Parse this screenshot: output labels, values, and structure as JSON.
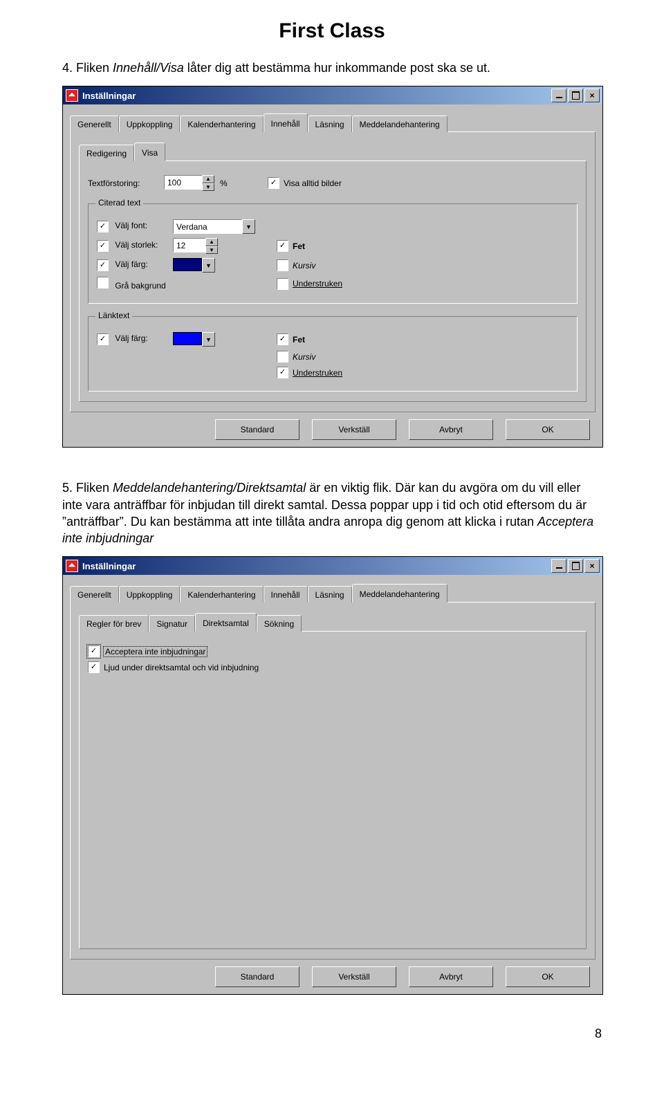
{
  "doc": {
    "title": "First Class",
    "para4_prefix": "4. Fliken ",
    "para4_em": "Innehåll/Visa",
    "para4_rest": " låter dig att bestämma hur inkommande post ska se ut.",
    "para5_prefix": "5. Fliken ",
    "para5_em": "Meddelandehantering/Direktsamtal",
    "para5_rest1": " är en viktig flik. Där kan du avgöra om du vill eller inte vara anträffbar för inbjudan till direkt samtal. Dessa poppar upp i tid och otid eftersom du är ”anträffbar”. Du kan bestämma att inte tillåta andra anropa dig genom att klicka i rutan ",
    "para5_em2": "Acceptera inte inbjudningar",
    "pagenum": "8"
  },
  "win1": {
    "title": "Inställningar",
    "tabs_outer": [
      "Generellt",
      "Uppkoppling",
      "Kalenderhantering",
      "Innehåll",
      "Läsning",
      "Meddelandehantering"
    ],
    "tabs_outer_active": 3,
    "tabs_inner": [
      "Redigering",
      "Visa"
    ],
    "tabs_inner_active": 1,
    "textzoom_label": "Textförstoring:",
    "textzoom_value": "100",
    "percent": "%",
    "show_images": "Visa alltid bilder",
    "group_quoted": "Citerad text",
    "choose_font": "Välj font:",
    "font_value": "Verdana",
    "choose_size": "Välj storlek:",
    "size_value": "12",
    "choose_color": "Välj färg:",
    "gray_bg": "Grå bakgrund",
    "bold": "Fet",
    "italic": "Kursiv",
    "underline": "Understruken",
    "group_link": "Länktext",
    "color_quoted": "#000080",
    "color_link": "#0000ff"
  },
  "win2": {
    "title": "Inställningar",
    "tabs_outer": [
      "Generellt",
      "Uppkoppling",
      "Kalenderhantering",
      "Innehåll",
      "Läsning",
      "Meddelandehantering"
    ],
    "tabs_outer_active": 5,
    "tabs_inner": [
      "Regler för brev",
      "Signatur",
      "Direktsamtal",
      "Sökning"
    ],
    "tabs_inner_active": 2,
    "opt1": "Acceptera inte inbjudningar",
    "opt2": "Ljud under direktsamtal och vid inbjudning"
  },
  "buttons": {
    "standard": "Standard",
    "apply": "Verkställ",
    "cancel": "Avbryt",
    "ok": "OK"
  }
}
